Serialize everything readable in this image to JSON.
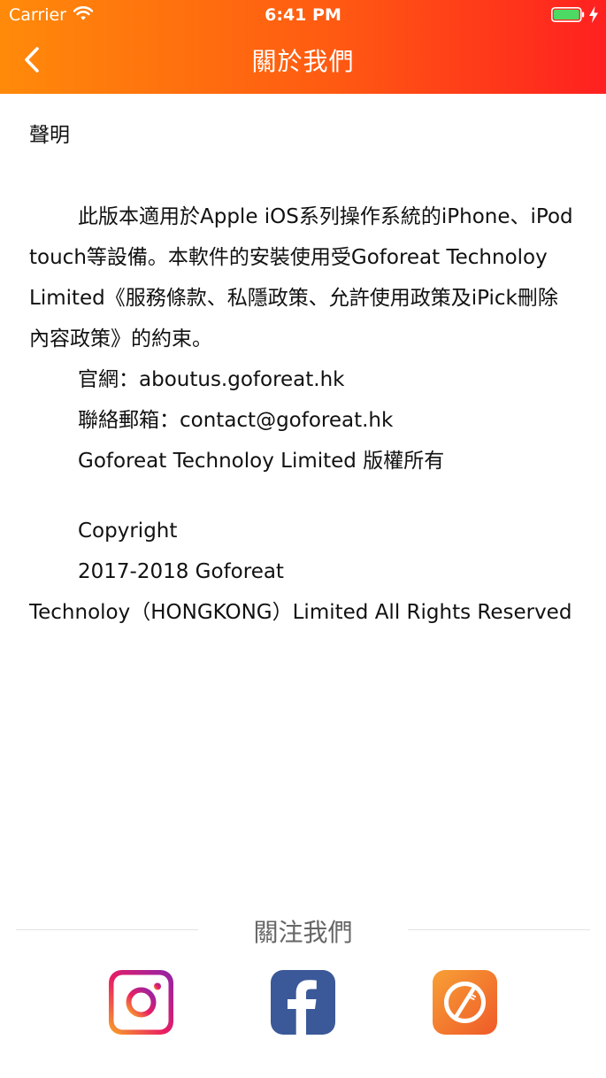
{
  "status_bar": {
    "carrier": "Carrier",
    "time": "6:41 PM"
  },
  "nav": {
    "title": "關於我們",
    "back_icon": "chevron-left-icon"
  },
  "content": {
    "section_title": "聲明",
    "paragraph": "此版本適用於Apple iOS系列操作系統的iPhone、iPod touch等設備。本軟件的安裝使用受Goforeat Technoloy Limited《服務條款、私隱政策、允許使用政策及iPick刪除內容政策》的約束。",
    "website_line": "官網：aboutus.goforeat.hk",
    "email_line": "聯絡郵箱：contact@goforeat.hk",
    "rights_line": "Goforeat Technoloy Limited 版權所有",
    "copyright_label": "Copyright",
    "copyright_years": "2017-2018  Goforeat",
    "copyright_company": "Technoloy（HONGKONG）Limited All Rights Reserved"
  },
  "follow": {
    "label": "關注我們",
    "icons": [
      "instagram-icon",
      "facebook-icon",
      "goforeat-icon"
    ]
  },
  "colors": {
    "header_start": "#ff8a0a",
    "header_end": "#ff2020",
    "battery": "#4cd964"
  }
}
